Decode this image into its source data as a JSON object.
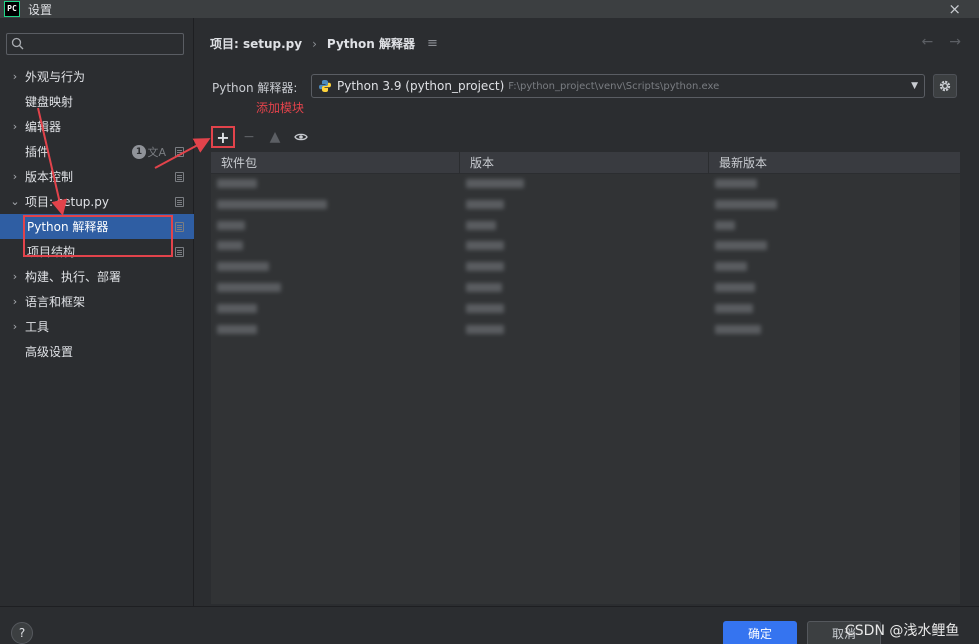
{
  "window": {
    "title": "设置",
    "app_logo": "PC",
    "close_icon": "×"
  },
  "sidebar": {
    "search_placeholder": "",
    "items": [
      {
        "label": "外观与行为",
        "chevron": "›",
        "expanded": false
      },
      {
        "label": "键盘映射",
        "chevron": ""
      },
      {
        "label": "编辑器",
        "chevron": "›"
      },
      {
        "label": "插件",
        "chevron": "",
        "badge": "1"
      },
      {
        "label": "版本控制",
        "chevron": "›"
      },
      {
        "label": "项目: setup.py",
        "chevron": "⌄",
        "expanded": true
      },
      {
        "label": "Python 解释器",
        "selected": true
      },
      {
        "label": "项目结构"
      },
      {
        "label": "构建、执行、部署",
        "chevron": "›"
      },
      {
        "label": "语言和框架",
        "chevron": "›"
      },
      {
        "label": "工具",
        "chevron": "›"
      },
      {
        "label": "高级设置",
        "chevron": ""
      }
    ]
  },
  "breadcrumb": {
    "project": "项目: setup.py",
    "separator": "›",
    "page": "Python 解释器"
  },
  "interpreter": {
    "label": "Python 解释器:",
    "name": "Python 3.9 (python_project)",
    "path": "F:\\python_project\\venv\\Scripts\\python.exe"
  },
  "annotation": {
    "text": "添加模块",
    "color": "#e2434b"
  },
  "toolbar": {
    "add": "+",
    "remove": "−",
    "upgrade": "▲"
  },
  "table": {
    "columns": [
      "软件包",
      "版本",
      "最新版本"
    ],
    "row_count": 9
  },
  "footer": {
    "help": "?",
    "ok": "确定",
    "cancel": "取消"
  },
  "watermark": "CSDN @浅水鲤鱼",
  "colors": {
    "accent": "#3574f0",
    "selection": "#2f5ea3",
    "annotation": "#e2434b"
  }
}
